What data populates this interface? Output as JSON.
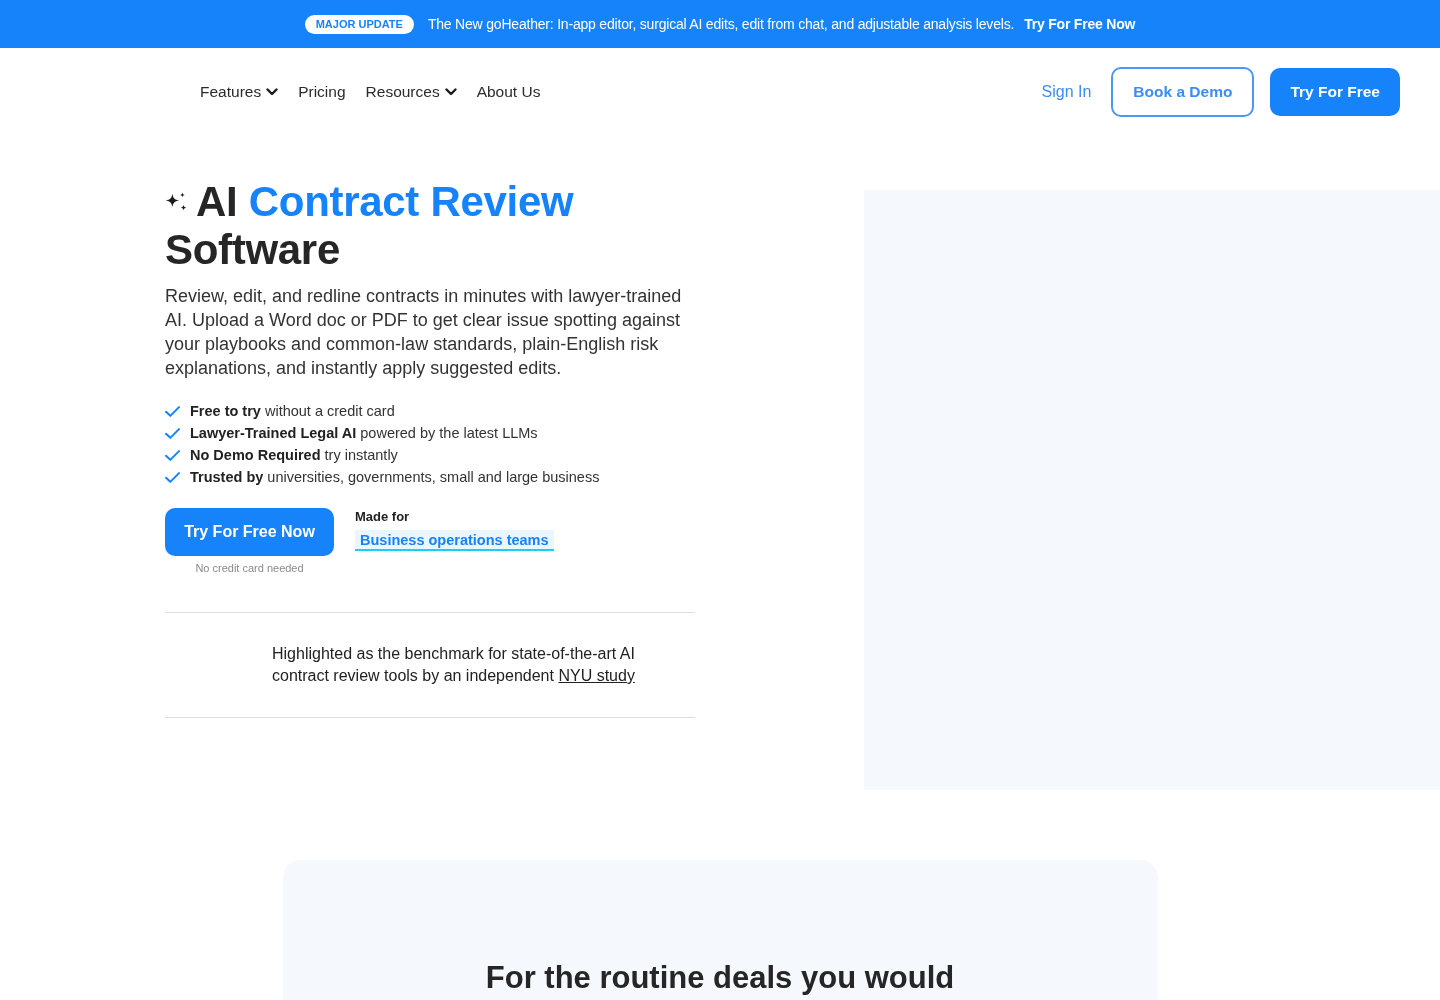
{
  "announcement_bar": {
    "badge": "MAJOR UPDATE",
    "message": "The New goHeather: In-app editor, surgical AI edits, edit from chat, and adjustable analysis levels.",
    "link": "Try For Free Now"
  },
  "nav": {
    "items": [
      {
        "label": "Features",
        "has_dropdown": true
      },
      {
        "label": "Pricing",
        "has_dropdown": false
      },
      {
        "label": "Resources",
        "has_dropdown": true
      },
      {
        "label": "About Us",
        "has_dropdown": false
      }
    ],
    "sign_in": "Sign In",
    "buttons": [
      {
        "label": "Book a Demo",
        "kind": "outline"
      },
      {
        "label": "Try For Free",
        "kind": "primary"
      }
    ]
  },
  "hero": {
    "title": {
      "lead": "AI",
      "highlight": "Contract Review",
      "rest": "Software"
    },
    "description": "Review, edit, and redline contracts in minutes with lawyer-trained AI. Upload a Word doc or PDF to get clear issue spotting against your playbooks and common-law standards, plain-English risk explanations, and instantly apply suggested edits.",
    "features": [
      "**Free to try** without a credit card",
      "**Lawyer-Trained Legal AI** powered by the latest LLMs",
      "**No Demo Required** try instantly",
      "**Trusted by** universities, governments, small and large business"
    ],
    "cta": {
      "button": "Try For Free Now",
      "note": "No credit card needed"
    },
    "made_for": {
      "label": "Made for",
      "value": "Business operations teams"
    },
    "recognition": {
      "text": "Highlighted as the benchmark for state-of-the-art AI contract review tools by an independent",
      "link": "NYU study"
    }
  },
  "section": {
    "heading": "For the routine deals you would"
  }
}
